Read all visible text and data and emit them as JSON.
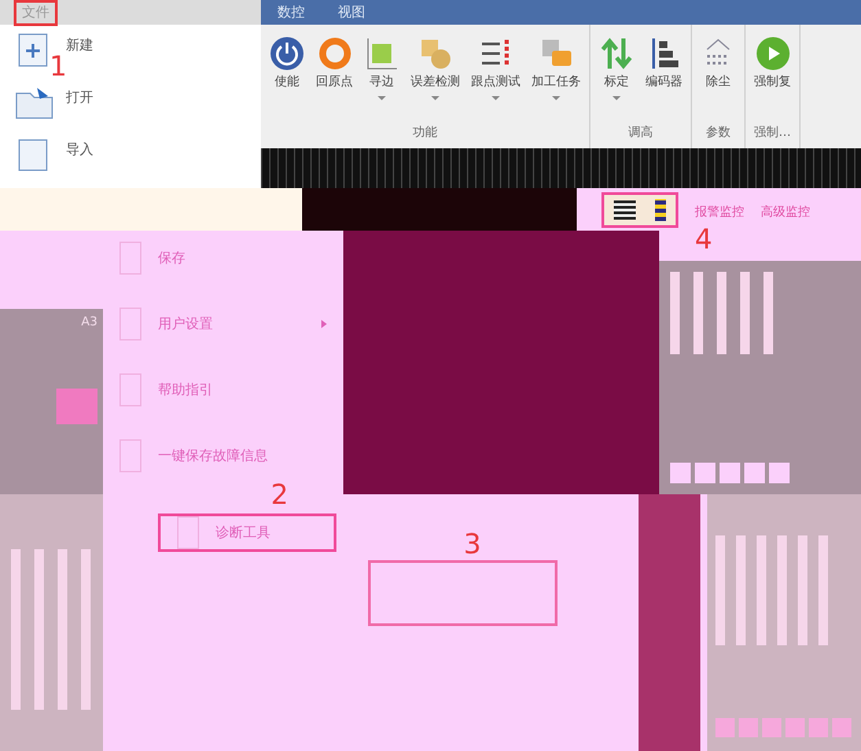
{
  "file_menu": {
    "tab": {
      "label": "文件",
      "highlighted": true
    },
    "items": [
      {
        "label": "新建",
        "kind": "new"
      },
      {
        "label": "打开",
        "kind": "open"
      },
      {
        "label": "导入",
        "kind": "import"
      }
    ]
  },
  "ribbon": {
    "tabs": [
      {
        "label": "数控"
      },
      {
        "label": "视图"
      }
    ],
    "groups": [
      {
        "label": "功能",
        "buttons": [
          {
            "label": "使能",
            "kind": "power",
            "has_menu": false
          },
          {
            "label": "回原点",
            "kind": "ring",
            "has_menu": false
          },
          {
            "label": "寻边",
            "kind": "edge",
            "has_menu": true
          },
          {
            "label": "误差检测",
            "kind": "coins",
            "has_menu": true
          },
          {
            "label": "跟点测试",
            "kind": "lines",
            "has_menu": true
          },
          {
            "label": "加工任务",
            "kind": "task",
            "has_menu": true
          }
        ]
      },
      {
        "label": "调高",
        "buttons": [
          {
            "label": "标定",
            "kind": "arrows",
            "has_menu": true
          },
          {
            "label": "编码器",
            "kind": "bars",
            "has_menu": false
          }
        ]
      },
      {
        "label": "参数",
        "buttons": [
          {
            "label": "除尘",
            "kind": "dots",
            "has_menu": false
          }
        ]
      },
      {
        "label": "强制…",
        "buttons": [
          {
            "label": "强制复",
            "kind": "play",
            "has_menu": false
          }
        ]
      }
    ]
  },
  "monitor_tabs": [
    {
      "label": "报警监控"
    },
    {
      "label": "高级监控"
    }
  ],
  "dropdown": {
    "items": [
      {
        "label": "保存",
        "submenu": false,
        "highlighted": false
      },
      {
        "label": "用户设置",
        "submenu": true,
        "highlighted": false
      },
      {
        "label": "帮助指引",
        "submenu": false,
        "highlighted": false
      },
      {
        "label": "一键保存故障信息",
        "submenu": false,
        "highlighted": false
      },
      {
        "label": "诊断工具",
        "submenu": false,
        "highlighted": true
      }
    ]
  },
  "left_panel": {
    "title": "A3"
  },
  "annotations": [
    "1",
    "2",
    "3",
    "4"
  ]
}
